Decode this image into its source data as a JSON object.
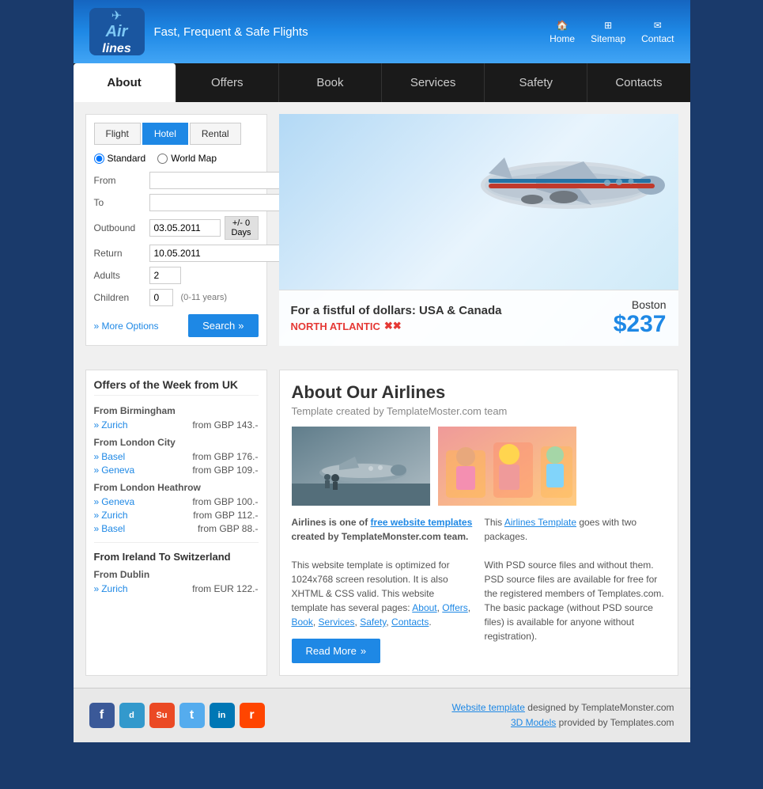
{
  "header": {
    "logo_text": "Air\nlines",
    "tagline": "Fast, Frequent & Safe Flights",
    "nav_items": [
      {
        "label": "Home",
        "icon": "🏠"
      },
      {
        "label": "Sitemap",
        "icon": "🗺"
      },
      {
        "label": "Contact",
        "icon": "✉"
      }
    ]
  },
  "main_nav": {
    "items": [
      {
        "label": "About",
        "active": true
      },
      {
        "label": "Offers",
        "active": false
      },
      {
        "label": "Book",
        "active": false
      },
      {
        "label": "Services",
        "active": false
      },
      {
        "label": "Safety",
        "active": false
      },
      {
        "label": "Contacts",
        "active": false
      }
    ]
  },
  "booking": {
    "tabs": [
      "Flight",
      "Hotel",
      "Rental"
    ],
    "active_tab": "Hotel",
    "radio_options": [
      "Standard",
      "World Map"
    ],
    "active_radio": "Standard",
    "fields": {
      "from_label": "From",
      "to_label": "To",
      "outbound_label": "Outbound",
      "outbound_value": "03.05.2011",
      "days_btn": "+/- 0 Days",
      "return_label": "Return",
      "return_value": "10.05.2011",
      "adults_label": "Adults",
      "adults_value": "2",
      "children_label": "Children",
      "children_value": "0",
      "children_note": "(0-11 years)"
    },
    "more_options": "More Options",
    "search_btn": "Search"
  },
  "hero": {
    "promo_title": "For a fistful of dollars: USA & Canada",
    "promo_subtitle": "NORTH ATLANTIC",
    "promo_city": "Boston",
    "promo_price": "$237"
  },
  "offers": {
    "title": "Offers of the Week from UK",
    "from_birmingham": {
      "label": "From Birmingham",
      "items": [
        {
          "city": "Zurich",
          "price": "from GBP 143.-"
        }
      ]
    },
    "from_london_city": {
      "label": "From London City",
      "items": [
        {
          "city": "Basel",
          "price": "from GBP 176.-"
        },
        {
          "city": "Geneva",
          "price": "from GBP 109.-"
        }
      ]
    },
    "from_london_heathrow": {
      "label": "From London Heathrow",
      "items": [
        {
          "city": "Geneva",
          "price": "from GBP 100.-"
        },
        {
          "city": "Zurich",
          "price": "from GBP 112.-"
        },
        {
          "city": "Basel",
          "price": "from GBP 88.-"
        }
      ]
    },
    "ireland_section_title": "From Ireland To Switzerland",
    "from_dublin": {
      "label": "From Dublin",
      "items": [
        {
          "city": "Zurich",
          "price": "from EUR 122.-"
        }
      ]
    }
  },
  "about": {
    "title": "About Our Airlines",
    "subtitle": "Template created by TemplateMoster.com team",
    "col1": {
      "text1_link": "free website templates",
      "text1_pre": "Airlines is one of ",
      "text1_post": " created by TemplateMonster.com team.",
      "text2": "This website template is optimized for 1024x768 screen resolution. It is also XHTML & CSS valid. This website template has several pages: ",
      "links": [
        "About",
        "Offers",
        "Book",
        "Services",
        "Safety",
        "Contacts"
      ]
    },
    "col2": {
      "text1_link": "Airlines Template",
      "text1_pre": "This ",
      "text1_post": " goes with two packages.",
      "text2": "With PSD source files and without them. PSD source files are available for free for the registered members of Templates.com. The basic package (without PSD source files) is available for anyone without registration)."
    },
    "read_more_btn": "Read More"
  },
  "footer": {
    "social_icons": [
      "f",
      "d",
      "su",
      "t",
      "in",
      "r"
    ],
    "text_line1_link": "Website template",
    "text_line1": " designed by TemplateMonster.com",
    "text_line2_link": "3D Models",
    "text_line2": " provided by Templates.com"
  }
}
